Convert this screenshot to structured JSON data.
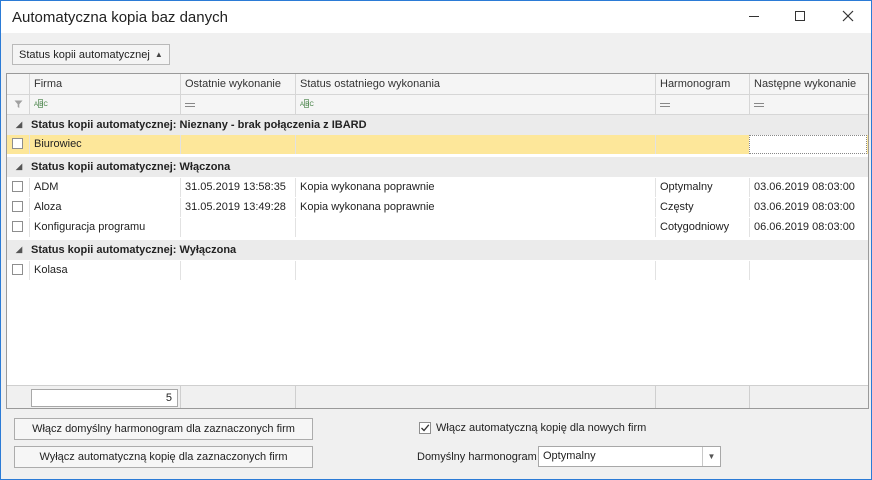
{
  "window": {
    "title": "Automatyczna kopia baz danych"
  },
  "group_button": {
    "label": "Status kopii automatycznej",
    "arrow_icon": "triangle-up-icon"
  },
  "columns": [
    "Firma",
    "Ostatnie wykonanie",
    "Status ostatniego wykonania",
    "Harmonogram",
    "Następne wykonanie"
  ],
  "groups": [
    {
      "label": "Status kopii automatycznej: Nieznany - brak połączenia z IBARD",
      "rows": [
        {
          "firma": "Biurowiec",
          "ostatnie": "",
          "status": "",
          "harmonogram": "",
          "nastepne": "",
          "selected": true
        }
      ]
    },
    {
      "label": "Status kopii automatycznej: Włączona",
      "rows": [
        {
          "firma": "ADM",
          "ostatnie": "31.05.2019 13:58:35",
          "status": "Kopia wykonana poprawnie",
          "harmonogram": "Optymalny",
          "nastepne": "03.06.2019 08:03:00",
          "selected": false
        },
        {
          "firma": "Aloza",
          "ostatnie": "31.05.2019 13:49:28",
          "status": "Kopia wykonana poprawnie",
          "harmonogram": "Częsty",
          "nastepne": "03.06.2019 08:03:00",
          "selected": false
        },
        {
          "firma": "Konfiguracja programu",
          "ostatnie": "",
          "status": "",
          "harmonogram": "Cotygodniowy",
          "nastepne": "06.06.2019 08:03:00",
          "selected": false
        }
      ]
    },
    {
      "label": "Status kopii automatycznej: Wyłączona",
      "rows": [
        {
          "firma": "Kolasa",
          "ostatnie": "",
          "status": "",
          "harmonogram": "",
          "nastepne": "",
          "selected": false
        }
      ]
    }
  ],
  "footer": {
    "count": "5"
  },
  "buttons": {
    "enable_schedule": "Włącz domyślny harmonogram dla zaznaczonych firm",
    "disable_backup": "Wyłącz automatyczną kopię dla zaznaczonych firm"
  },
  "options": {
    "auto_new_label": "Włącz automatyczną kopię dla nowych firm",
    "auto_new_checked": true,
    "default_schedule_label": "Domyślny harmonogram",
    "default_schedule_value": "Optymalny"
  },
  "colors": {
    "selected_row": "#fde79a",
    "window_border": "#2b7bd6"
  }
}
